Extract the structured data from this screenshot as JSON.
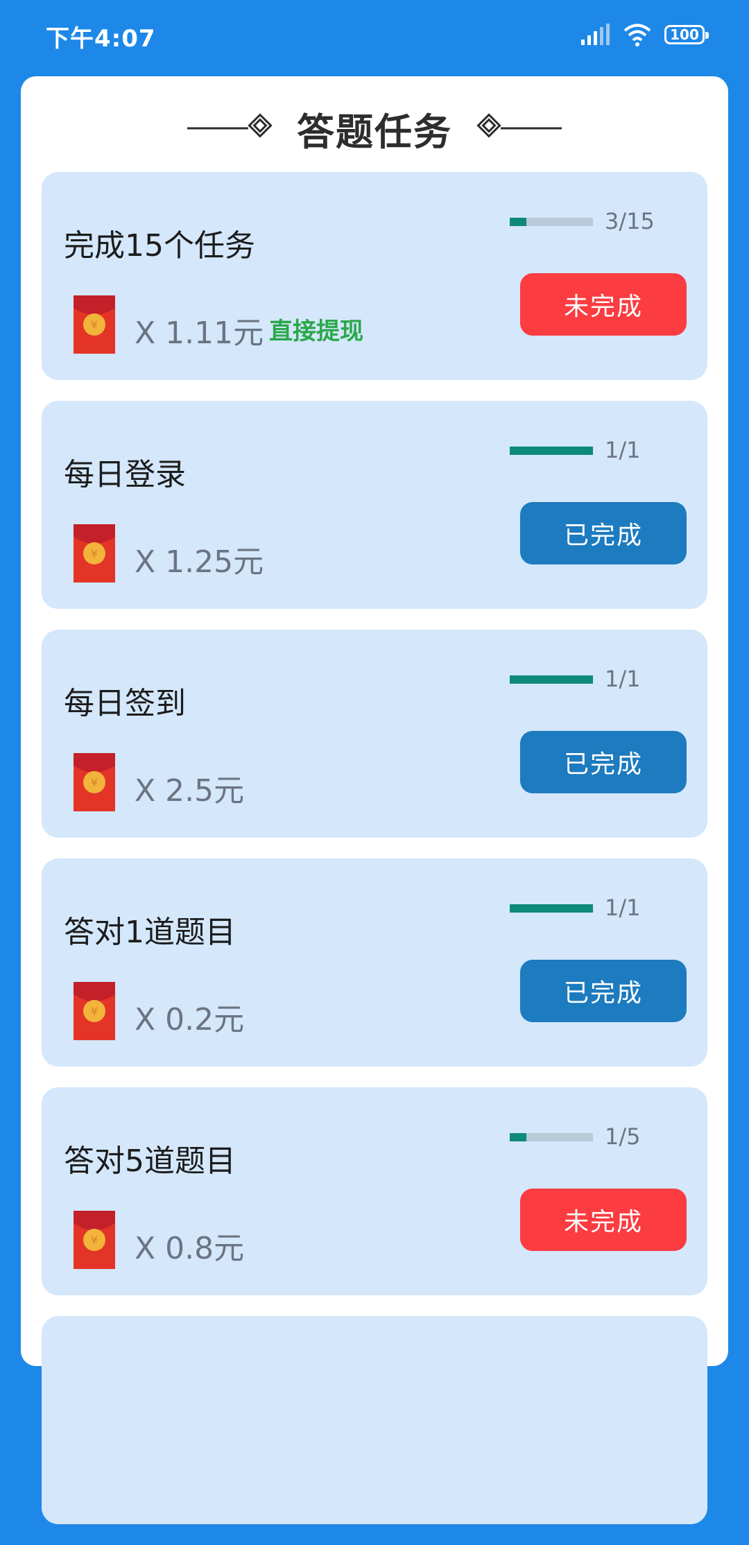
{
  "status_bar": {
    "time": "下午4:07",
    "battery": "100"
  },
  "page": {
    "title": "答题任务"
  },
  "colors": {
    "background": "#1e88e8",
    "card": "#d4e7fb",
    "incomplete": "#fb3c40",
    "complete": "#1d7bbf",
    "progress": "#0e8a7a",
    "highlight": "#2aa84a"
  },
  "tasks": [
    {
      "title": "完成15个任务",
      "reward": "X 1.11元",
      "note": "直接提现",
      "progress_text": "3/15",
      "progress": 0.2,
      "status": "未完成",
      "state": "incomplete"
    },
    {
      "title": "每日登录",
      "reward": "X 1.25元",
      "note": "",
      "progress_text": "1/1",
      "progress": 1.0,
      "status": "已完成",
      "state": "complete"
    },
    {
      "title": "每日签到",
      "reward": "X 2.5元",
      "note": "",
      "progress_text": "1/1",
      "progress": 1.0,
      "status": "已完成",
      "state": "complete"
    },
    {
      "title": "答对1道题目",
      "reward": "X 0.2元",
      "note": "",
      "progress_text": "1/1",
      "progress": 1.0,
      "status": "已完成",
      "state": "complete"
    },
    {
      "title": "答对5道题目",
      "reward": "X 0.8元",
      "note": "",
      "progress_text": "1/5",
      "progress": 0.2,
      "status": "未完成",
      "state": "incomplete"
    },
    {
      "title": "",
      "reward": "",
      "note": "",
      "progress_text": "",
      "progress": 0,
      "status": "",
      "state": "partial"
    }
  ]
}
